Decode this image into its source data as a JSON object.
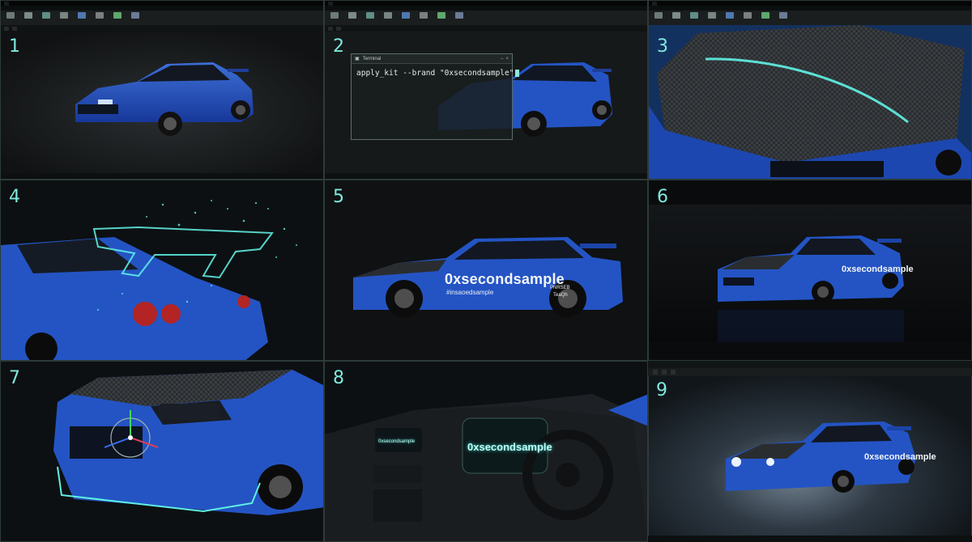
{
  "panels": [
    {
      "number": "1"
    },
    {
      "number": "2"
    },
    {
      "number": "3"
    },
    {
      "number": "4"
    },
    {
      "number": "5"
    },
    {
      "number": "6"
    },
    {
      "number": "7"
    },
    {
      "number": "8"
    },
    {
      "number": "9"
    }
  ],
  "terminal": {
    "title": "Terminal",
    "command": "apply_kit --brand \"0xsecondsample\""
  },
  "decals": {
    "door_text": "0xsecondsample",
    "door_subtext": "#insaoedsample",
    "rear_text": "PNRSEB",
    "rear_subtext": "TeaQh",
    "panel6_text": "0xsecondsample",
    "panel9_text": "0xsecondsample",
    "dash_text": "0xsecondsample",
    "dash_small_text": "0xsecondsample"
  },
  "colors": {
    "accent": "#7fe9df",
    "car_blue": "#1f4fb8",
    "carbon": "#2a2d30"
  },
  "icons": {
    "terminal": "terminal-icon",
    "transform_gizmo": "transform-gizmo-icon",
    "steering_wheel": "steering-wheel-icon"
  }
}
